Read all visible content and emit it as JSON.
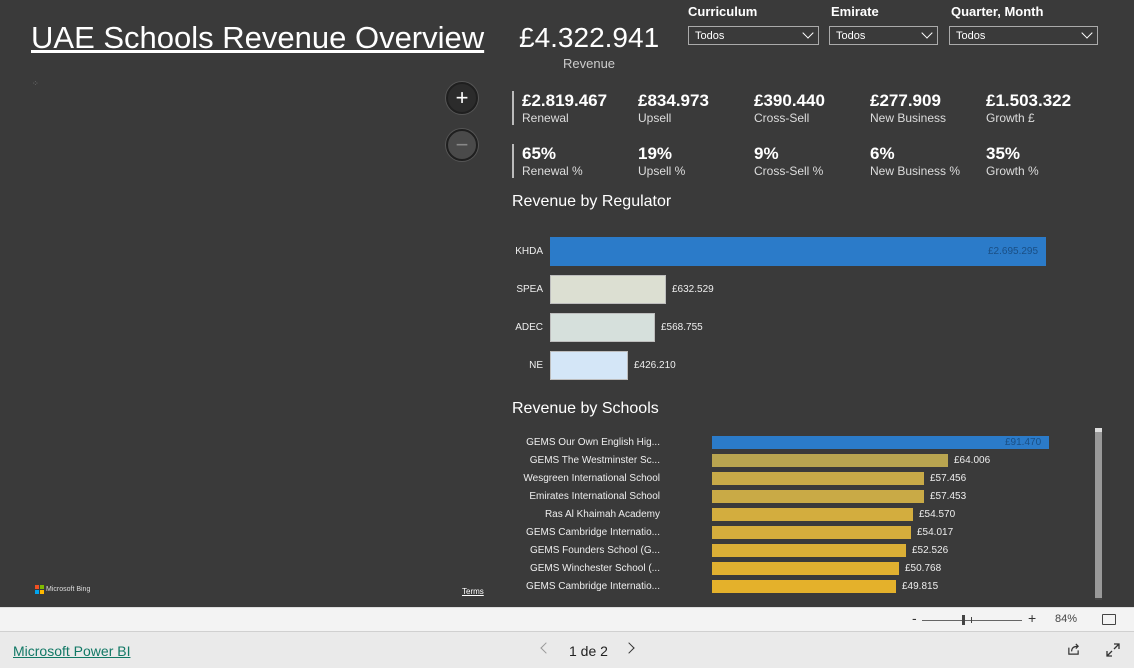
{
  "report": {
    "title": "UAE Schools Revenue Overview",
    "total_revenue_value": "£4.322.941",
    "total_revenue_label": "Revenue"
  },
  "slicers": [
    {
      "label": "Curriculum",
      "value": "Todos"
    },
    {
      "label": "Emirate",
      "value": "Todos"
    },
    {
      "label": "Quarter, Month",
      "value": "Todos"
    }
  ],
  "kpis_amount": [
    {
      "value": "£2.819.467",
      "label": "Renewal"
    },
    {
      "value": "£834.973",
      "label": "Upsell"
    },
    {
      "value": "£390.440",
      "label": "Cross-Sell"
    },
    {
      "value": "£277.909",
      "label": "New Business"
    },
    {
      "value": "£1.503.322",
      "label": "Growth £"
    }
  ],
  "kpis_pct": [
    {
      "value": "65%",
      "label": "Renewal %"
    },
    {
      "value": "19%",
      "label": "Upsell %"
    },
    {
      "value": "9%",
      "label": "Cross-Sell %"
    },
    {
      "value": "6%",
      "label": "New Business %"
    },
    {
      "value": "35%",
      "label": "Growth %"
    }
  ],
  "map": {
    "zoom_in": "+",
    "zoom_out": "−",
    "bing_label": "Microsoft Bing",
    "terms_label": "Terms"
  },
  "chart_data": [
    {
      "type": "bar",
      "orientation": "horizontal",
      "title": "Revenue by Regulator",
      "categories": [
        "KHDA",
        "SPEA",
        "ADEC",
        "NE"
      ],
      "values": [
        2695295,
        632529,
        568755,
        426210
      ],
      "labels": [
        "£2.695.295",
        "£632.529",
        "£568.755",
        "£426.210"
      ],
      "colors": [
        "#2b7bc9",
        "#dcdfd2",
        "#d6e0dc",
        "#d4e6f7"
      ],
      "xlim": [
        0,
        2695295
      ]
    },
    {
      "type": "bar",
      "orientation": "horizontal",
      "title": "Revenue by Schools",
      "categories": [
        "GEMS Our Own English Hig...",
        "GEMS The Westminster Sc...",
        "Wesgreen International School",
        "Emirates International School",
        "Ras Al Khaimah Academy",
        "GEMS Cambridge Internatio...",
        "GEMS Founders School (G...",
        "GEMS Winchester School (...",
        "GEMS Cambridge Internatio..."
      ],
      "values": [
        91470,
        64006,
        57456,
        57453,
        54570,
        54017,
        52526,
        50768,
        49815
      ],
      "labels": [
        "£91.470",
        "£64.006",
        "£57.456",
        "£57.453",
        "£54.570",
        "£54.017",
        "£52.526",
        "£50.768",
        "£49.815"
      ],
      "colors": [
        "#2b7bc9",
        "#b9a550",
        "#c8aa48",
        "#c9aa46",
        "#d3ad3e",
        "#d5ad3c",
        "#dbaf36",
        "#e0b030",
        "#e4b12b"
      ],
      "xlim": [
        0,
        91470
      ]
    }
  ],
  "zoombar": {
    "minus": "-",
    "plus": "+",
    "zoom_pct": "84%"
  },
  "footer": {
    "brand": "Microsoft Power BI",
    "page": "1 de 2"
  }
}
